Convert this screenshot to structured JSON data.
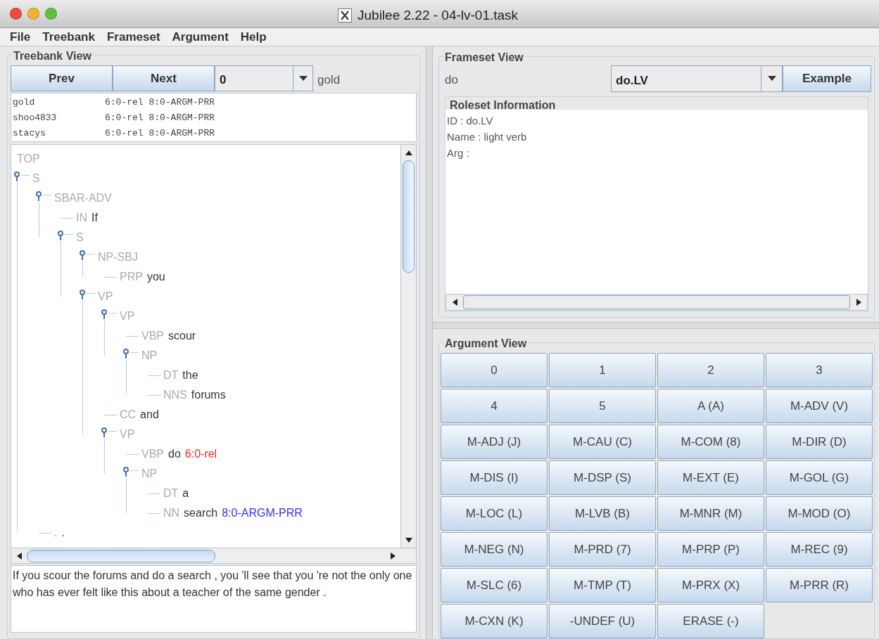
{
  "window": {
    "title": "Jubilee 2.22 - 04-lv-01.task"
  },
  "menu": [
    "File",
    "Treebank",
    "Frameset",
    "Argument",
    "Help"
  ],
  "treebank_view": {
    "title": "Treebank View",
    "prev": "Prev",
    "next": "Next",
    "index": "0",
    "annotator": "gold",
    "annotations": [
      {
        "annotator": "gold",
        "labels": "6:0-rel 8:0-ARGM-PRR"
      },
      {
        "annotator": "shoo4833",
        "labels": "6:0-rel 8:0-ARGM-PRR"
      },
      {
        "annotator": "stacys",
        "labels": "6:0-rel 8:0-ARGM-PRR"
      }
    ],
    "tree": {
      "label": "TOP",
      "children": [
        {
          "label": "S",
          "children": [
            {
              "label": "SBAR-ADV",
              "children": [
                {
                  "label": "IN",
                  "word": "If"
                },
                {
                  "label": "S",
                  "children": [
                    {
                      "label": "NP-SBJ",
                      "children": [
                        {
                          "label": "PRP",
                          "word": "you"
                        }
                      ]
                    },
                    {
                      "label": "VP",
                      "children": [
                        {
                          "label": "VP",
                          "children": [
                            {
                              "label": "VBP",
                              "word": "scour"
                            },
                            {
                              "label": "NP",
                              "children": [
                                {
                                  "label": "DT",
                                  "word": "the"
                                },
                                {
                                  "label": "NNS",
                                  "word": "forums"
                                }
                              ]
                            }
                          ]
                        },
                        {
                          "label": "CC",
                          "word": "and"
                        },
                        {
                          "label": "VP",
                          "children": [
                            {
                              "label": "VBP",
                              "word": "do",
                              "tag": "6:0-rel",
                              "color": "#ff2020"
                            },
                            {
                              "label": "NP",
                              "children": [
                                {
                                  "label": "DT",
                                  "word": "a"
                                },
                                {
                                  "label": "NN",
                                  "word": "search",
                                  "tag": "8:0-ARGM-PRR",
                                  "color": "#3030ff"
                                }
                              ]
                            }
                          ]
                        }
                      ]
                    }
                  ]
                }
              ]
            },
            {
              "label": ".",
              "word": "."
            }
          ]
        }
      ]
    },
    "sentence": "If you scour the forums and do a search , you 'll see that you 're not the only one who has ever felt like this about a teacher of the same gender ."
  },
  "frameset_view": {
    "title": "Frameset View",
    "lemma": "do",
    "roleset": "do.LV",
    "example": "Example",
    "roleset_information": {
      "title": "Roleset Information",
      "lines": [
        "ID : do.LV",
        "Name : light verb",
        "Arg :"
      ]
    }
  },
  "argument_view": {
    "title": "Argument View",
    "buttons": [
      "0",
      "1",
      "2",
      "3",
      "4",
      "5",
      "A (A)",
      "M-ADV (V)",
      "M-ADJ (J)",
      "M-CAU (C)",
      "M-COM (8)",
      "M-DIR (D)",
      "M-DIS (I)",
      "M-DSP (S)",
      "M-EXT (E)",
      "M-GOL (G)",
      "M-LOC (L)",
      "M-LVB (B)",
      "M-MNR (M)",
      "M-MOD (O)",
      "M-NEG (N)",
      "M-PRD (7)",
      "M-PRP (P)",
      "M-REC (9)",
      "M-SLC (6)",
      "M-TMP (T)",
      "M-PRX (X)",
      "M-PRR (R)",
      "M-CXN (K)",
      "-UNDEF (U)",
      "ERASE (-)"
    ]
  }
}
